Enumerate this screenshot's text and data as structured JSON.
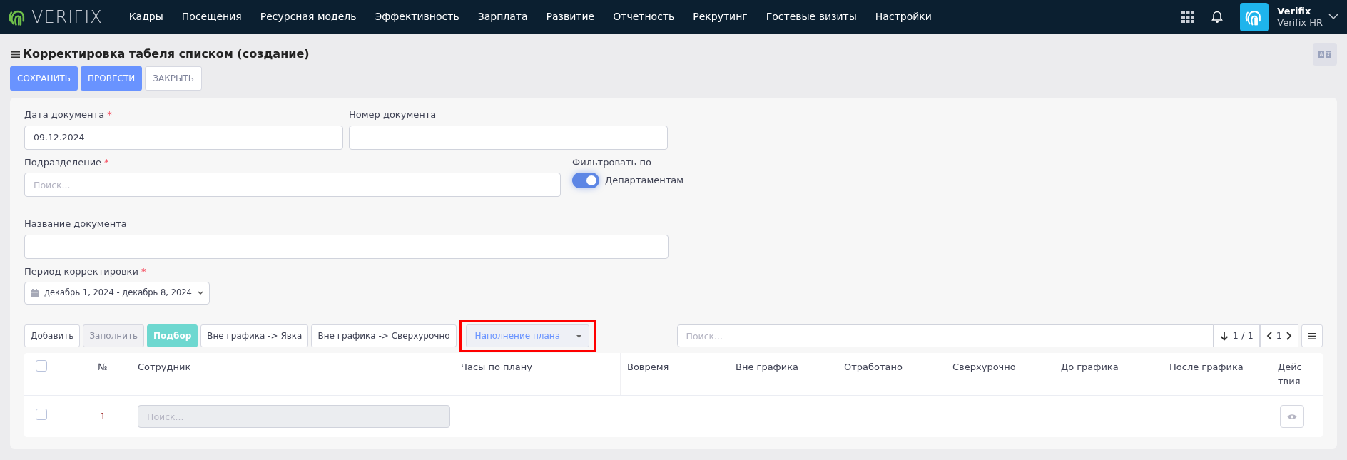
{
  "nav": {
    "logo_text": "VERIFIX",
    "menu": [
      "Кадры",
      "Посещения",
      "Ресурсная модель",
      "Эффективность",
      "Зарплата",
      "Развитие",
      "Отчетность",
      "Рекрутинг",
      "Гостевые визиты",
      "Настройки"
    ],
    "user": {
      "name": "Verifix",
      "company": "Verifix HR"
    }
  },
  "page": {
    "title": "Корректировка табеля списком (создание)"
  },
  "actions": [
    {
      "label": "СОХРАНИТЬ",
      "kind": "primary"
    },
    {
      "label": "ПРОВЕСТИ",
      "kind": "primary"
    },
    {
      "label": "ЗАКРЫТЬ",
      "kind": "plain"
    }
  ],
  "form": {
    "date": {
      "label": "Дата документа",
      "required_mark": "*",
      "value": "09.12.2024"
    },
    "number": {
      "label": "Номер документа"
    },
    "division": {
      "label": "Подразделение",
      "required_mark": "*",
      "placeholder": "Поиск..."
    },
    "filter": {
      "label": "Фильтровать по",
      "option": "Департаментам",
      "on": true
    },
    "name": {
      "label": "Название документа"
    },
    "period": {
      "label": "Период корректировки",
      "required_mark": "*",
      "value": "декабрь 1, 2024 - декабрь 8, 2024"
    }
  },
  "toolbar": [
    {
      "label": "Добавить",
      "kind": "plain",
      "disabled": false,
      "highlighted": false
    },
    {
      "label": "Заполнить",
      "kind": "plain",
      "disabled": true,
      "highlighted": false
    },
    {
      "label": "Подбор",
      "kind": "accent",
      "disabled": false,
      "highlighted": false
    },
    {
      "label": "Вне графика -> Явка",
      "kind": "plain",
      "disabled": false,
      "highlighted": false
    },
    {
      "label": "Вне графика -> Сверхурочно",
      "kind": "plain",
      "disabled": false,
      "highlighted": false
    },
    {
      "label": "Наполнение плана",
      "kind": "split",
      "highlighted": true
    }
  ],
  "table_search": {
    "placeholder": "Поиск...",
    "count": "1 / 1",
    "page": "1"
  },
  "table": {
    "columns": [
      "№",
      "Сотрудник",
      "Часы по плану",
      "Вовремя",
      "Вне графика",
      "Отработано",
      "Сверхурочно",
      "До графика",
      "После графика",
      "Действия"
    ],
    "rows": [
      {
        "number": "1",
        "checked": false,
        "employee_placeholder": "Поиск..."
      }
    ],
    "all_checked": false
  }
}
